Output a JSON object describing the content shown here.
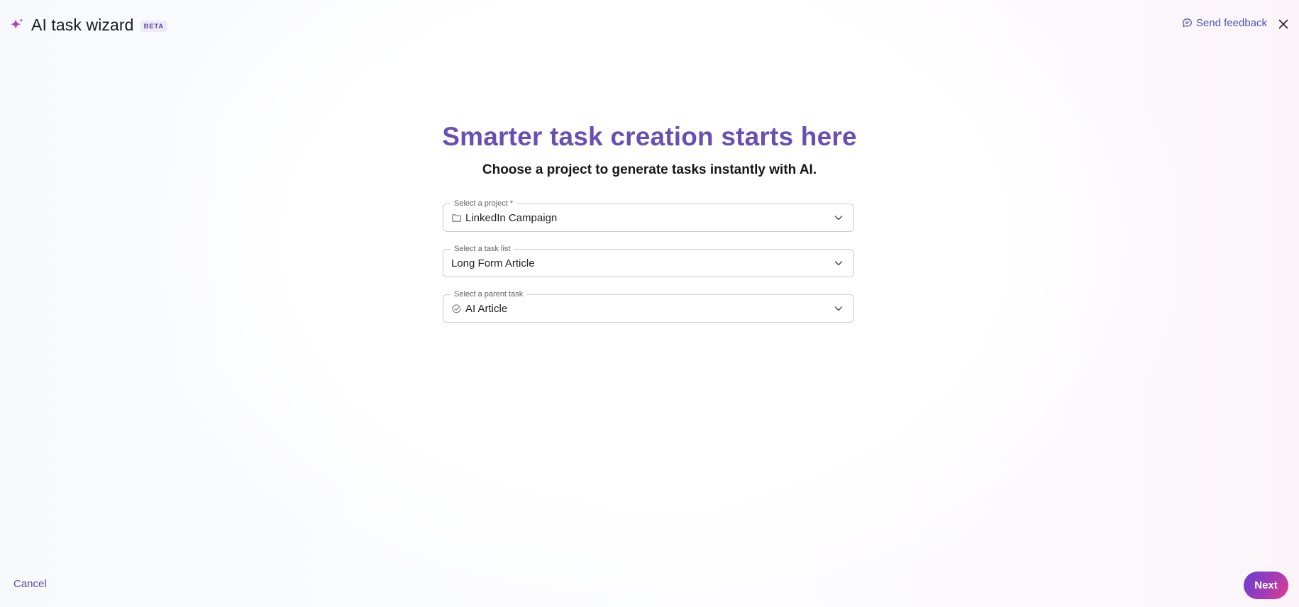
{
  "header": {
    "icon": "sparkle-icon",
    "title": "AI task wizard",
    "badge": "BETA",
    "feedback_label": "Send feedback",
    "feedback_icon": "chat-bubble-icon",
    "close_icon": "close-icon"
  },
  "main": {
    "title": "Smarter task creation starts here",
    "subtitle": "Choose a project to generate tasks instantly with AI.",
    "fields": [
      {
        "label": "Select a project *",
        "value": "LinkedIn Campaign",
        "icon": "folder-icon"
      },
      {
        "label": "Select a task list",
        "value": "Long Form Article",
        "icon": ""
      },
      {
        "label": "Select a parent task",
        "value": "AI Article",
        "icon": "check-circle-icon"
      }
    ]
  },
  "footer": {
    "cancel_label": "Cancel",
    "next_label": "Next"
  },
  "colors": {
    "accent_purple": "#6a4fb3",
    "link_blue": "#4a56b8",
    "next_gradient_start": "#6a3fd1",
    "next_gradient_end": "#e33b8c"
  }
}
